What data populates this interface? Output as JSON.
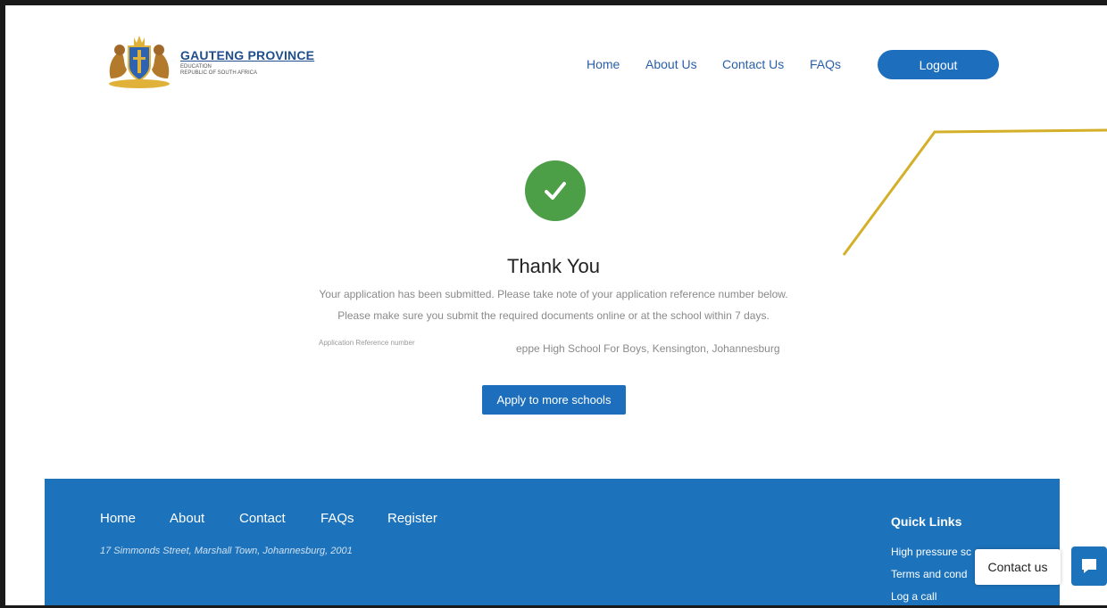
{
  "header": {
    "logo_title": "GAUTENG PROVINCE",
    "logo_subtitle_1": "EDUCATION",
    "logo_subtitle_2": "REPUBLIC OF SOUTH AFRICA",
    "nav": [
      {
        "label": "Home"
      },
      {
        "label": "About Us"
      },
      {
        "label": "Contact Us"
      },
      {
        "label": "FAQs"
      }
    ],
    "logout_label": "Logout"
  },
  "confirmation": {
    "title": "Thank You",
    "message_1": "Your application has been submitted. Please take note of your application reference number below.",
    "message_2": "Please make sure you submit the required documents online or at the school within 7 days.",
    "reference_label": "Application Reference number",
    "school": "eppe High School For Boys, Kensington, Johannesburg",
    "apply_button": "Apply to more schools"
  },
  "footer": {
    "links": [
      {
        "label": "Home"
      },
      {
        "label": "About"
      },
      {
        "label": "Contact"
      },
      {
        "label": "FAQs"
      },
      {
        "label": "Register"
      }
    ],
    "address": "17 Simmonds Street, Marshall Town, Johannesburg, 2001",
    "quick_links_title": "Quick Links",
    "quick_links": [
      {
        "label": "High pressure sc"
      },
      {
        "label": "Terms and cond"
      },
      {
        "label": "Log a call"
      }
    ]
  },
  "chat": {
    "label": "Contact us",
    "icon": "chat-bubble-icon"
  },
  "colors": {
    "primary": "#1d6fbd",
    "footer": "#1d73bb",
    "success": "#4c9e47",
    "accent_line": "#d4b02a"
  }
}
